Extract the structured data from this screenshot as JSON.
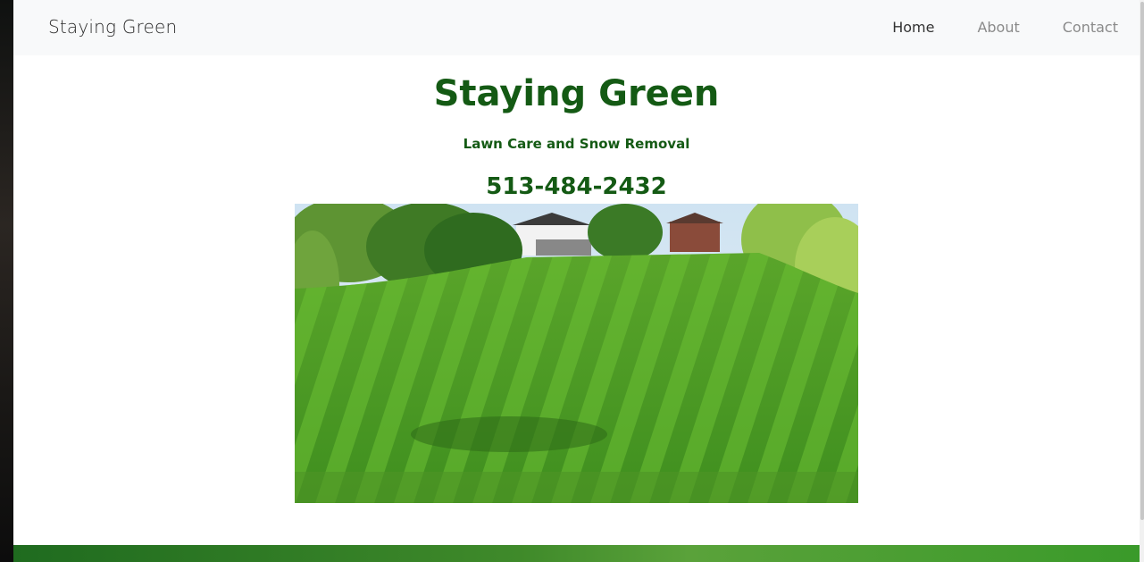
{
  "navbar": {
    "brand": "Staying Green",
    "links": [
      {
        "label": "Home",
        "active": true
      },
      {
        "label": "About",
        "active": false
      },
      {
        "label": "Contact",
        "active": false
      }
    ]
  },
  "hero": {
    "title": "Staying Green",
    "subtitle": "Lawn Care and Snow Removal",
    "phone": "513-484-2432"
  },
  "colors": {
    "brand_green": "#145a14",
    "navbar_bg": "#f8f9fa",
    "footer_gradient_start": "#1f6b1f",
    "footer_gradient_end": "#3a9a2a"
  }
}
